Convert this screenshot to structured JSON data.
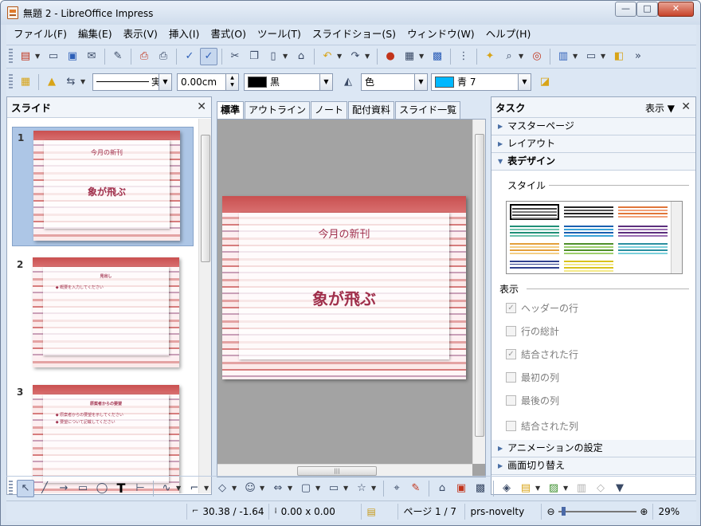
{
  "window": {
    "title": "無題 2 - LibreOffice Impress"
  },
  "menu": [
    "ファイル(F)",
    "編集(E)",
    "表示(V)",
    "挿入(I)",
    "書式(O)",
    "ツール(T)",
    "スライドショー(S)",
    "ウィンドウ(W)",
    "ヘルプ(H)"
  ],
  "line_toolbar": {
    "line_style": "実",
    "line_width": "0.00cm",
    "line_color": "黒",
    "area_style": "色",
    "area_color": "青 7",
    "line_color_hex": "#000000",
    "area_color_hex": "#00b8ff"
  },
  "slides_panel": {
    "title": "スライド"
  },
  "slides": [
    {
      "number": "1",
      "title": "今月の新刊",
      "subtitle": "象が飛ぶ"
    },
    {
      "number": "2",
      "title": "見出し",
      "bullets": [
        "概要を入力してください"
      ]
    },
    {
      "number": "3",
      "title": "原案者からの要望",
      "bullets": [
        "原案者からの要望を示してください",
        "要望について記載してください"
      ]
    }
  ],
  "editor": {
    "tabs": [
      "標準",
      "アウトライン",
      "ノート",
      "配付資料",
      "スライド一覧"
    ],
    "active_tab": "標準",
    "slide_title": "今月の新刊",
    "slide_subtitle": "象が飛ぶ"
  },
  "task_panel": {
    "title": "タスク",
    "view_label": "表示",
    "sections": [
      "マスターページ",
      "レイアウト",
      "表デザイン",
      "アニメーションの設定",
      "画面切り替え"
    ],
    "styles_label": "スタイル",
    "display_label": "表示",
    "options": [
      {
        "label": "ヘッダーの行",
        "checked": true
      },
      {
        "label": "行の総計",
        "checked": false
      },
      {
        "label": "結合された行",
        "checked": true
      },
      {
        "label": "最初の列",
        "checked": false
      },
      {
        "label": "最後の列",
        "checked": false
      },
      {
        "label": "結合された列",
        "checked": false
      }
    ]
  },
  "status": {
    "position": "30.38 / -1.64",
    "size": "0.00 x 0.00",
    "page": "ページ 1 / 7",
    "master": "prs-novelty",
    "zoom": "29%"
  }
}
